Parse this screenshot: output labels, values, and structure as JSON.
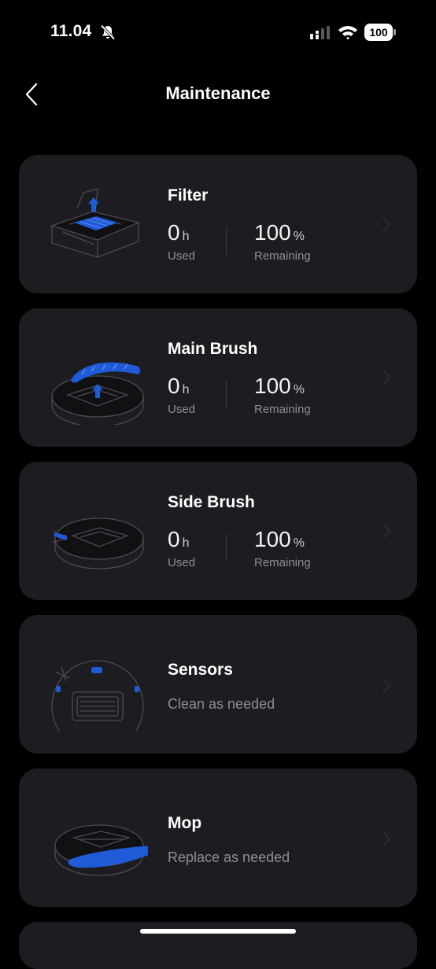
{
  "status_bar": {
    "time": "11.04",
    "battery": "100"
  },
  "header": {
    "title": "Maintenance"
  },
  "cards": [
    {
      "title": "Filter",
      "used_value": "0",
      "used_unit": "h",
      "used_label": "Used",
      "remaining_value": "100",
      "remaining_unit": "%",
      "remaining_label": "Remaining"
    },
    {
      "title": "Main Brush",
      "used_value": "0",
      "used_unit": "h",
      "used_label": "Used",
      "remaining_value": "100",
      "remaining_unit": "%",
      "remaining_label": "Remaining"
    },
    {
      "title": "Side Brush",
      "used_value": "0",
      "used_unit": "h",
      "used_label": "Used",
      "remaining_value": "100",
      "remaining_unit": "%",
      "remaining_label": "Remaining"
    },
    {
      "title": "Sensors",
      "subtitle": "Clean as needed"
    },
    {
      "title": "Mop",
      "subtitle": "Replace as needed"
    }
  ],
  "colors": {
    "background": "#000000",
    "card": "#1c1c21",
    "accent": "#1f5bd6",
    "secondary_text": "#8e8e93"
  },
  "icons": [
    "bell-slash-icon",
    "signal-icon",
    "wifi-icon",
    "back-chevron-icon",
    "chevron-right-icon"
  ]
}
